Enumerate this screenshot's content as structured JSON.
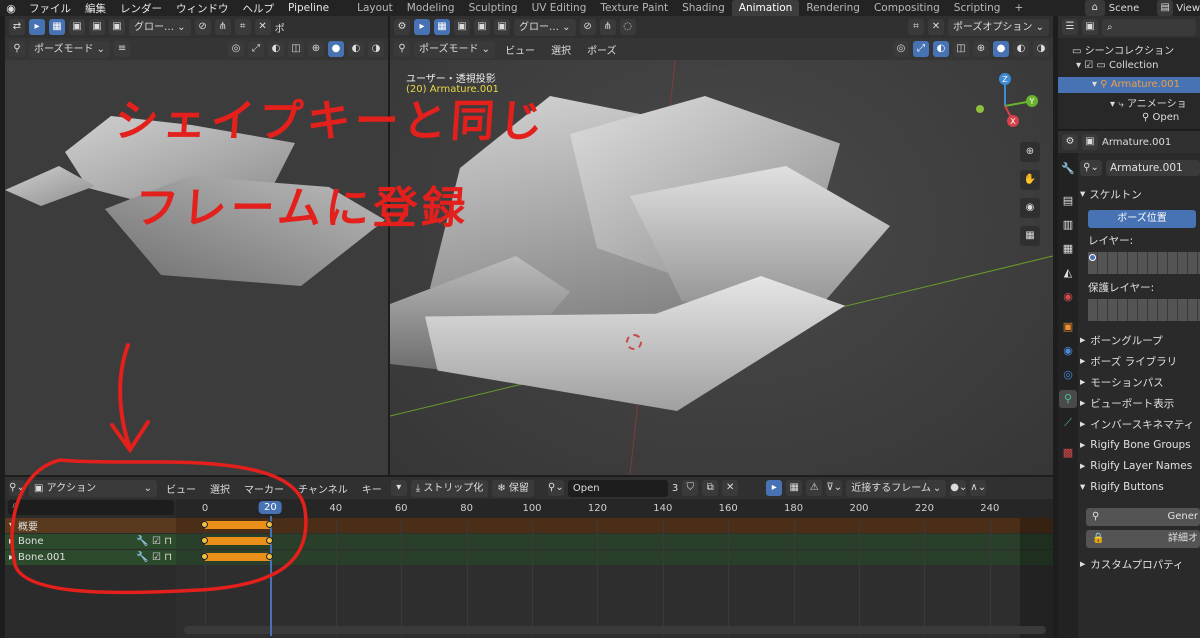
{
  "app": {
    "menus": [
      "ファイル",
      "編集",
      "レンダー",
      "ウィンドウ",
      "ヘルプ",
      "Pipeline"
    ],
    "workspaces": [
      "Layout",
      "Modeling",
      "Sculpting",
      "UV Editing",
      "Texture Paint",
      "Shading",
      "Animation",
      "Rendering",
      "Compositing",
      "Scripting"
    ],
    "active_workspace": "Animation",
    "add_tab": "+",
    "scene_label": "Scene",
    "view_layer_label": "View"
  },
  "left_viewport": {
    "orientation": "グロー…",
    "mode": "ポーズモード",
    "extra": "ポ"
  },
  "main_viewport": {
    "orientation": "グロー…",
    "options": "ポーズオプション",
    "mode": "ポーズモード",
    "menus": [
      "ビュー",
      "選択",
      "ポーズ"
    ],
    "view_title": "ユーザー・透視投影",
    "object_label": "(20) Armature.001",
    "gizmo_axes": {
      "z": "Z",
      "y": "Y",
      "x": "X"
    }
  },
  "annotation": {
    "line1": "シェイプキーと同じ",
    "line2": "フレームに登録",
    "color": "#e3201b"
  },
  "outliner": {
    "title": "シーンコレクション",
    "items": [
      {
        "label": "Collection"
      },
      {
        "label": "Armature.001"
      },
      {
        "label": "アニメーショ"
      },
      {
        "label": "Open"
      }
    ]
  },
  "properties": {
    "header_object": "Armature.001",
    "data_name": "Armature.001",
    "skeleton_panel": "スケルトン",
    "pose_position_btn": "ボーズ位置",
    "layers_label": "レイヤー:",
    "protected_layers_label": "保護レイヤー:",
    "panels": [
      "ボーングループ",
      "ボーズ ライブラリ",
      "モーションパス",
      "ビューポート表示",
      "インバースキネマティ",
      "Rigify Bone Groups",
      "Rigify Layer Names",
      "Rigify Buttons"
    ],
    "generate_btn": "Gener",
    "advanced_btn": "詳細オ",
    "custom_props": "カスタムプロパティ"
  },
  "timeline": {
    "mode": "アクション",
    "menus": [
      "ビュー",
      "選択",
      "マーカー",
      "チャンネル",
      "キー"
    ],
    "stash_btn": "ストリップ化",
    "push_btn": "保留",
    "action_name": "Open",
    "user_count": "3",
    "snap_mode": "近接するフレーム",
    "current_frame": "20",
    "channels": [
      {
        "label": "概要"
      },
      {
        "label": "Bone"
      },
      {
        "label": "Bone.001"
      }
    ],
    "ticks": [
      "0",
      "20",
      "40",
      "60",
      "80",
      "100",
      "120",
      "140",
      "160",
      "180",
      "200",
      "220",
      "240"
    ],
    "tick_values": [
      0,
      20,
      40,
      60,
      80,
      100,
      120,
      140,
      160,
      180,
      200,
      220,
      240
    ],
    "keys": [
      {
        "start": 0,
        "end": 20
      }
    ],
    "accent": "#4772b3",
    "key_color": "#f0c040"
  }
}
